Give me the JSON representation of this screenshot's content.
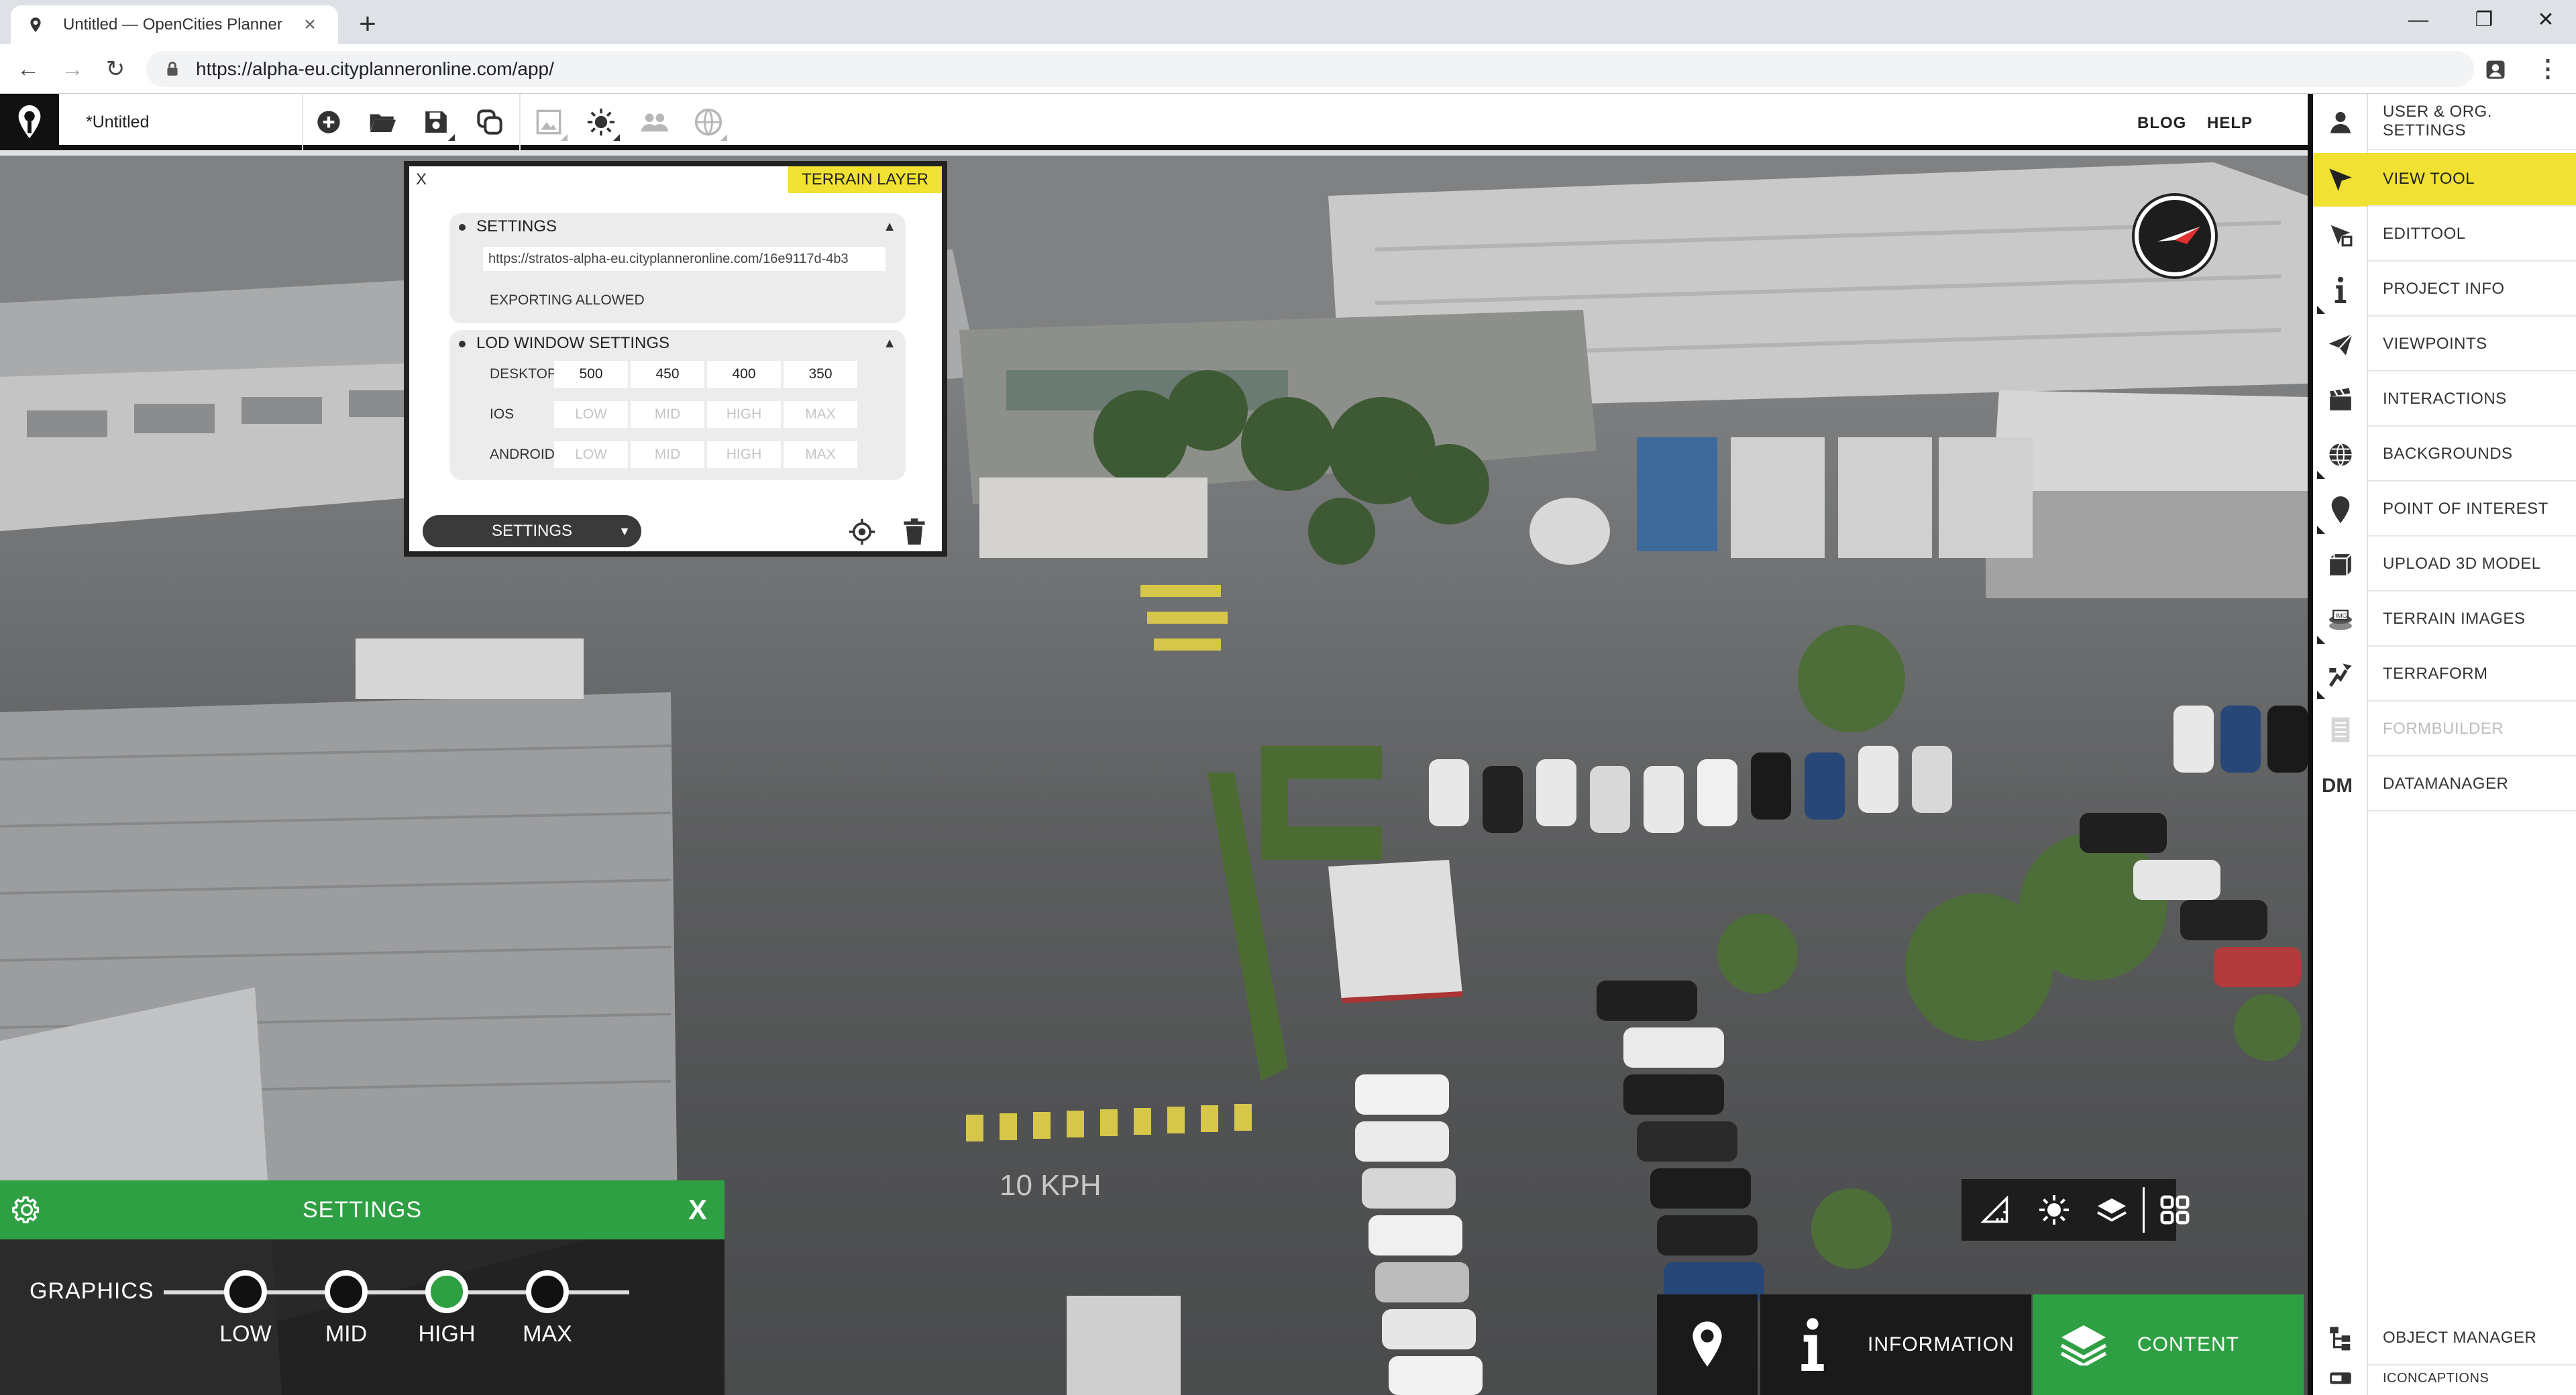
{
  "browser": {
    "tab_title": "Untitled — OpenCities Planner",
    "url": "https://alpha-eu.cityplanneronline.com/app/"
  },
  "app": {
    "doc_title": "*Untitled",
    "links": {
      "blog": "BLOG",
      "help": "HELP"
    }
  },
  "right_panel": {
    "user_settings": "USER & ORG. SETTINGS",
    "tools": [
      {
        "label": "VIEW TOOL",
        "icon": "cursor-arrow-icon",
        "active": true
      },
      {
        "label": "EDITTOOL",
        "icon": "edit-arrow-icon"
      },
      {
        "label": "PROJECT INFO",
        "icon": "info-icon"
      },
      {
        "label": "VIEWPOINTS",
        "icon": "paper-plane-icon"
      },
      {
        "label": "INTERACTIONS",
        "icon": "clapperboard-icon"
      },
      {
        "label": "BACKGROUNDS",
        "icon": "globe-icon"
      },
      {
        "label": "POINT OF INTEREST",
        "icon": "map-pin-icon"
      },
      {
        "label": "UPLOAD 3D MODEL",
        "icon": "cube-icon"
      },
      {
        "label": "TERRAIN IMAGES",
        "icon": "img-stack-icon"
      },
      {
        "label": "TERRAFORM",
        "icon": "terraform-icon"
      },
      {
        "label": "FORMBUILDER",
        "icon": "form-icon",
        "disabled": true
      },
      {
        "label": "DATAMANAGER",
        "icon": "dm-icon"
      }
    ],
    "object_manager": "OBJECT MANAGER",
    "iconcaptions": "ICONCAPTIONS"
  },
  "terrain_dialog": {
    "close": "X",
    "tag": "TERRAIN LAYER",
    "settings_header": "SETTINGS",
    "url_value": "https://stratos-alpha-eu.cityplanneronline.com/16e9117d-4b3",
    "exporting": "EXPORTING ALLOWED",
    "lod_header": "LOD WINDOW SETTINGS",
    "rows": [
      {
        "label": "DESKTOP",
        "cells": [
          "500",
          "450",
          "400",
          "350"
        ],
        "placeholder": false
      },
      {
        "label": "IOS",
        "cells": [
          "LOW",
          "MID",
          "HIGH",
          "MAX"
        ],
        "placeholder": true
      },
      {
        "label": "ANDROID",
        "cells": [
          "LOW",
          "MID",
          "HIGH",
          "MAX"
        ],
        "placeholder": true
      }
    ],
    "select_label": "SETTINGS"
  },
  "graphics_panel": {
    "title": "SETTINGS",
    "close": "X",
    "label": "GRAPHICS",
    "levels": [
      "LOW",
      "MID",
      "HIGH",
      "MAX"
    ],
    "selected": "HIGH"
  },
  "bottom_nav": {
    "information": "INFORMATION",
    "content": "CONTENT"
  },
  "scene_labels": {
    "road_text": "10 KPH"
  },
  "colors": {
    "accent_yellow": "#f0e132",
    "accent_green": "#2ea043",
    "chrome_dark": "#111111"
  }
}
